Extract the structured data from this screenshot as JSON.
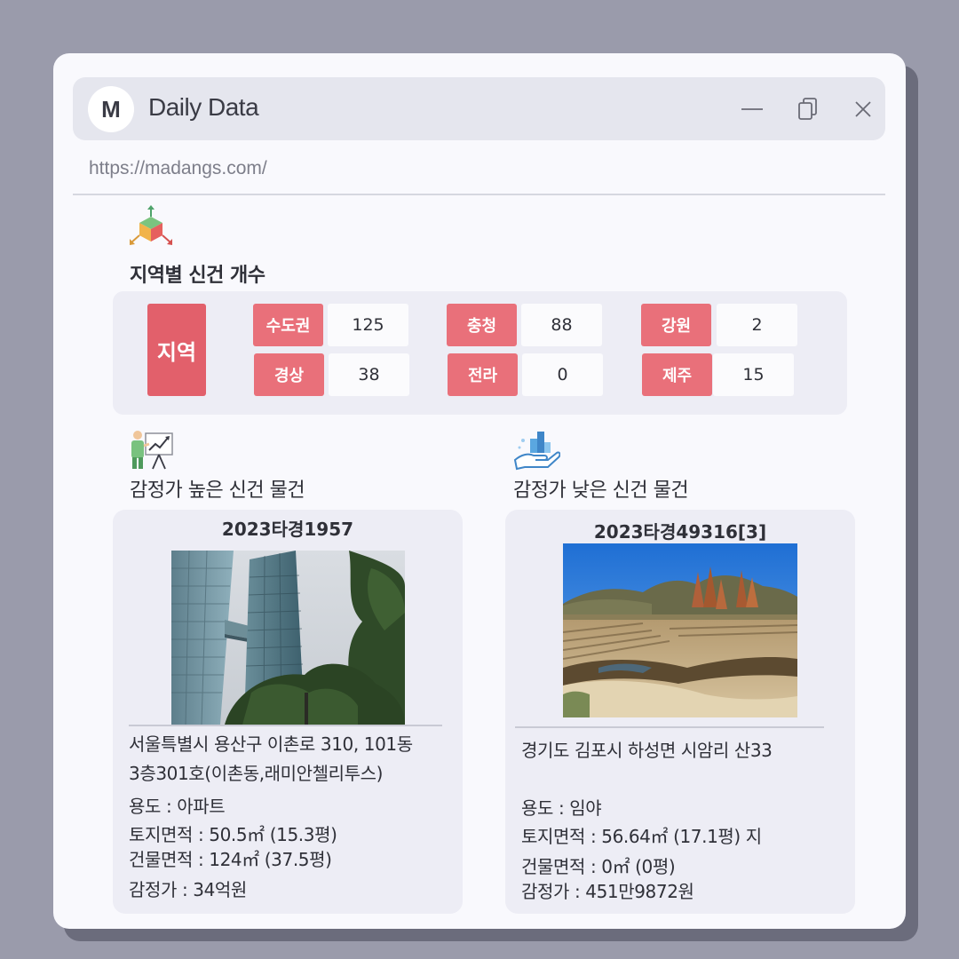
{
  "app": {
    "logo_letter": "M",
    "title": "Daily Data",
    "url": "https://madangs.com/"
  },
  "region_section": {
    "title": "지역별 신건 개수",
    "icon": "cube-arrows-icon",
    "main_label": "지역",
    "regions": [
      {
        "name": "수도권",
        "count": "125"
      },
      {
        "name": "충청",
        "count": "88"
      },
      {
        "name": "강원",
        "count": "2"
      },
      {
        "name": "경상",
        "count": "38"
      },
      {
        "name": "전라",
        "count": "0"
      },
      {
        "name": "제주",
        "count": "15"
      }
    ]
  },
  "high_section": {
    "title": "감정가 높은 신건 물건",
    "icon": "presentation-chart-icon",
    "case_no": "2023타경1957",
    "address_line1": "서울특별시 용산구 이촌로 310, 101동",
    "address_line2": "3층301호(이촌동,래미안첼리투스)",
    "usage": "용도 : 아파트",
    "land_area": "토지면적 : 50.5㎡ (15.3평)",
    "building_area": "건물면적 : 124㎡ (37.5평)",
    "appraisal": "감정가 : 34억원"
  },
  "low_section": {
    "title": "감정가 낮은 신건 물건",
    "icon": "hand-bar-chart-icon",
    "case_no": "2023타경49316[3]",
    "address_line1": "경기도 김포시 하성면 시암리 산33",
    "usage": "용도 :  임야",
    "land_area": "토지면적 : 56.64㎡ (17.1평) 지",
    "building_area": "건물면적 : 0㎡ (0평)",
    "appraisal": "감정가 : 451만9872원"
  },
  "colors": {
    "accent_dark": "#e2606b",
    "accent": "#e9707a",
    "panel": "#ededf5",
    "background": "#9a9bab"
  }
}
